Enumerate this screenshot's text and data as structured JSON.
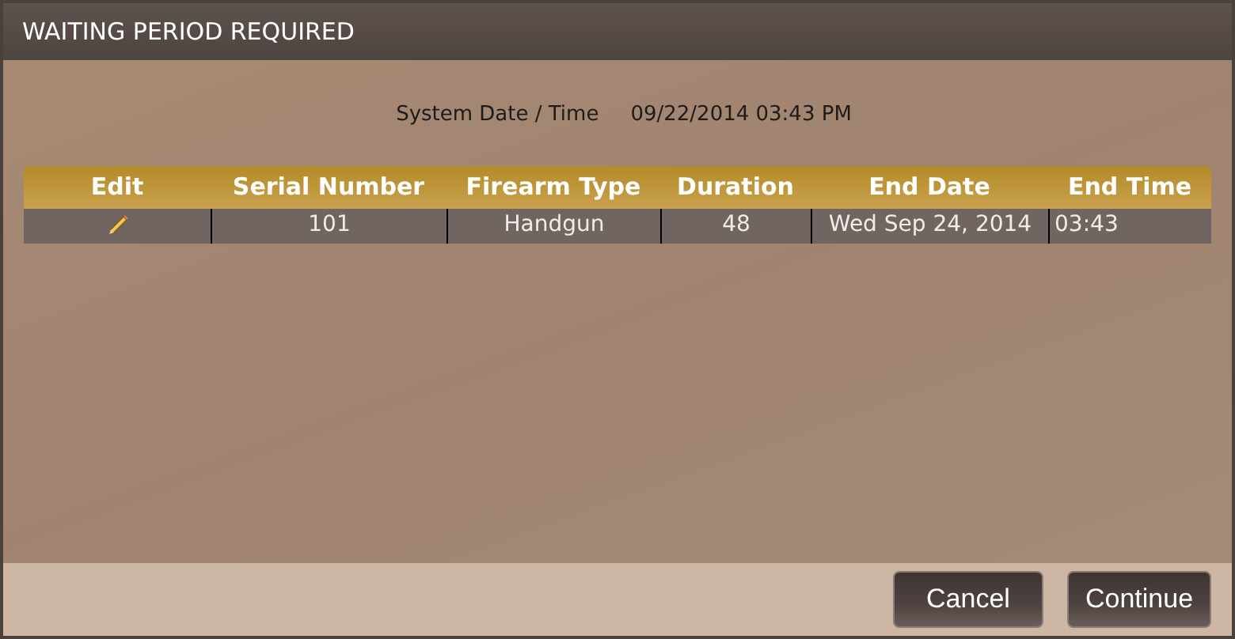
{
  "window": {
    "title": "WAITING PERIOD REQUIRED"
  },
  "system_time": {
    "label": "System Date / Time",
    "value": "09/22/2014 03:43 PM"
  },
  "table": {
    "columns": [
      "Edit",
      "Serial Number",
      "Firearm Type",
      "Duration",
      "End Date",
      "End Time"
    ],
    "rows": [
      {
        "cells": [
          "",
          "101",
          "Handgun",
          "48",
          "Wed Sep 24, 2014",
          "03:43"
        ]
      }
    ]
  },
  "buttons": [
    "Cancel",
    "Continue"
  ]
}
